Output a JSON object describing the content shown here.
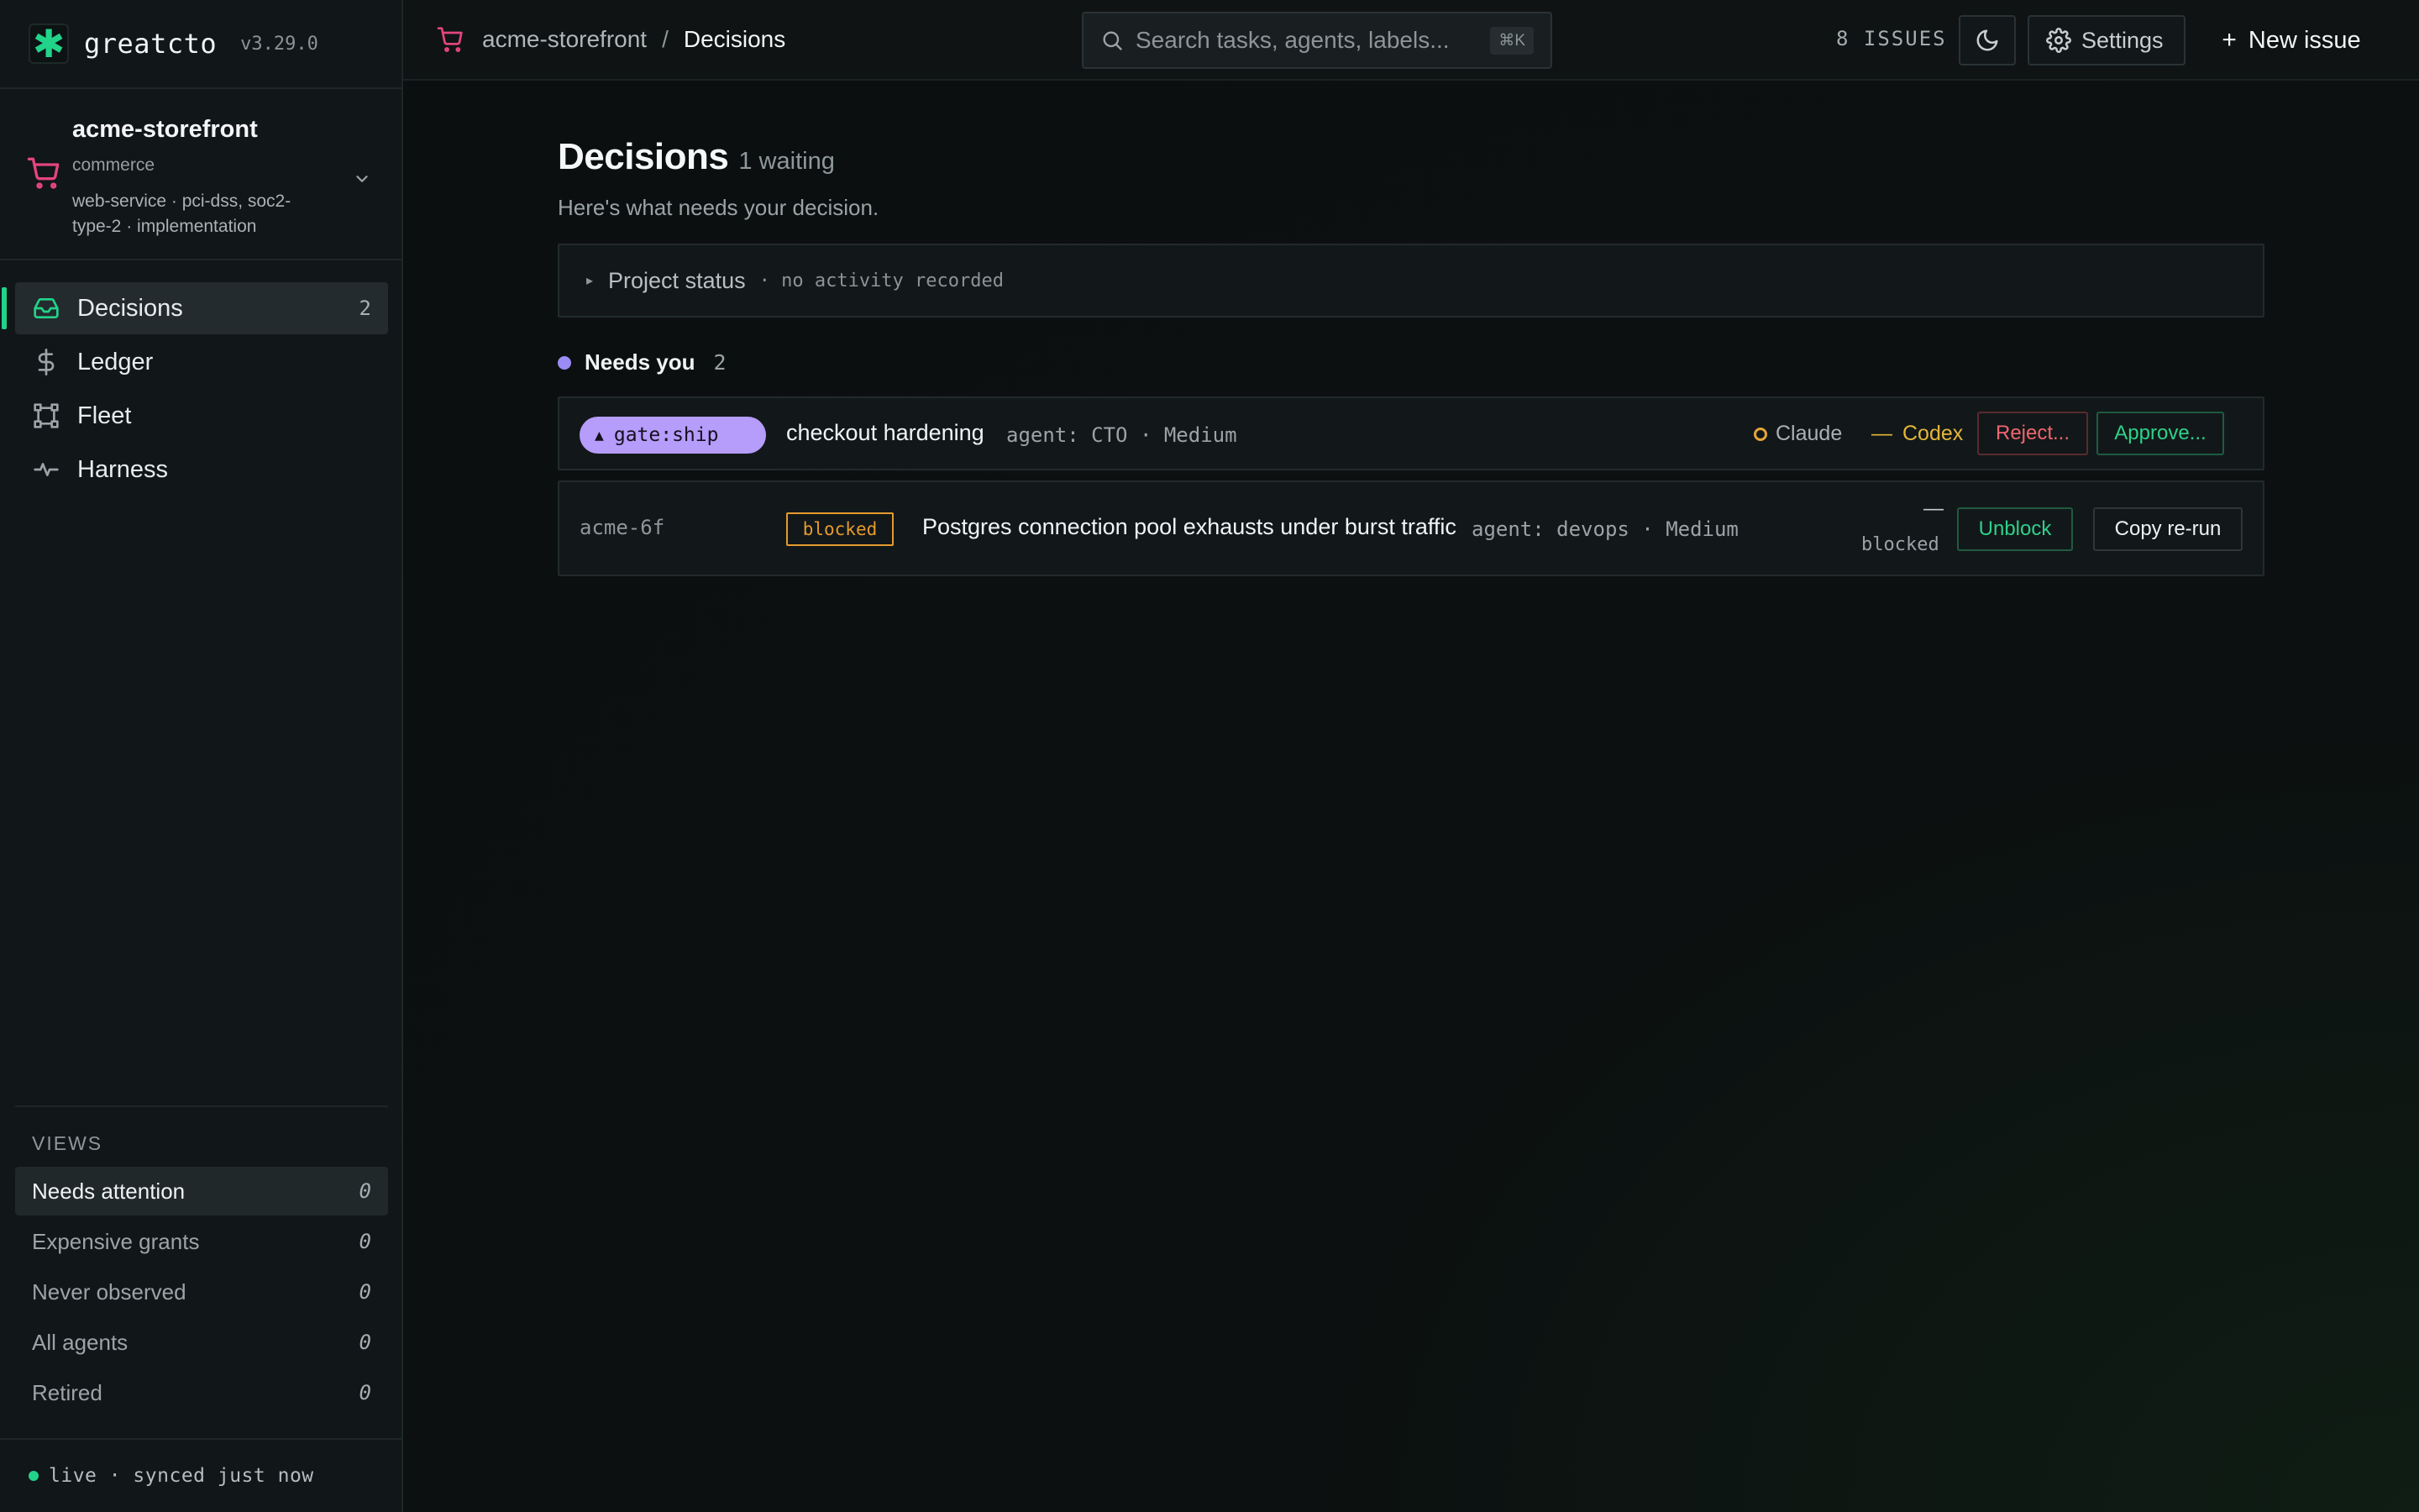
{
  "app": {
    "name": "greatcto",
    "version": "v3.29.0",
    "accent": "#22d38a"
  },
  "project": {
    "name": "acme-storefront",
    "type": "commerce",
    "tags": "web-service · pci-dss, soc2-type-2 · implementation",
    "icon": "shopping-cart-icon",
    "icon_color": "#e4457f"
  },
  "nav": {
    "items": [
      {
        "label": "Decisions",
        "count": "2",
        "icon": "inbox-icon"
      },
      {
        "label": "Ledger",
        "count": "",
        "icon": "dollar-icon"
      },
      {
        "label": "Fleet",
        "count": "",
        "icon": "fleet-icon"
      },
      {
        "label": "Harness",
        "count": "",
        "icon": "pulse-icon"
      }
    ]
  },
  "views": {
    "title": "VIEWS",
    "items": [
      {
        "label": "Needs attention",
        "count": "0"
      },
      {
        "label": "Expensive grants",
        "count": "0"
      },
      {
        "label": "Never observed",
        "count": "0"
      },
      {
        "label": "All agents",
        "count": "0"
      },
      {
        "label": "Retired",
        "count": "0"
      }
    ]
  },
  "live": {
    "text": "live · synced just now"
  },
  "topbar": {
    "breadcrumb_project": "acme-storefront",
    "breadcrumb_sep": "/",
    "breadcrumb_page": "Decisions",
    "search_placeholder": "Search tasks, agents, labels...",
    "search_shortcut": "⌘K",
    "issues_count": "8 ISSUES",
    "settings_label": "Settings",
    "new_issue_label": "New issue"
  },
  "main": {
    "title": "Decisions",
    "waiting": "1 waiting",
    "subtitle": "Here's what needs your decision.",
    "project_status": {
      "label": "Project status",
      "note": "· no activity recorded"
    },
    "section": {
      "label": "Needs you",
      "count": "2"
    },
    "gate_row": {
      "gate_label": "gate:ship",
      "title": "checkout hardening",
      "meta": "agent: CTO · Medium",
      "claude_label": "Claude",
      "codex_label": "Codex",
      "reject_label": "Reject...",
      "approve_label": "Approve..."
    },
    "blocked_row": {
      "id": "acme-6f",
      "badge": "blocked",
      "title": "Postgres connection pool exhausts under burst traffic",
      "meta": "agent: devops · Medium",
      "dash": "—",
      "state": "blocked",
      "unblock_label": "Unblock",
      "rerun_label": "Copy re-run"
    }
  },
  "colors": {
    "gate_pill": "#b69cfb",
    "blocked": "#e59a2e",
    "reject": "#f0656f",
    "approve": "#2fd18b",
    "section_dot": "#9b8cf5"
  }
}
